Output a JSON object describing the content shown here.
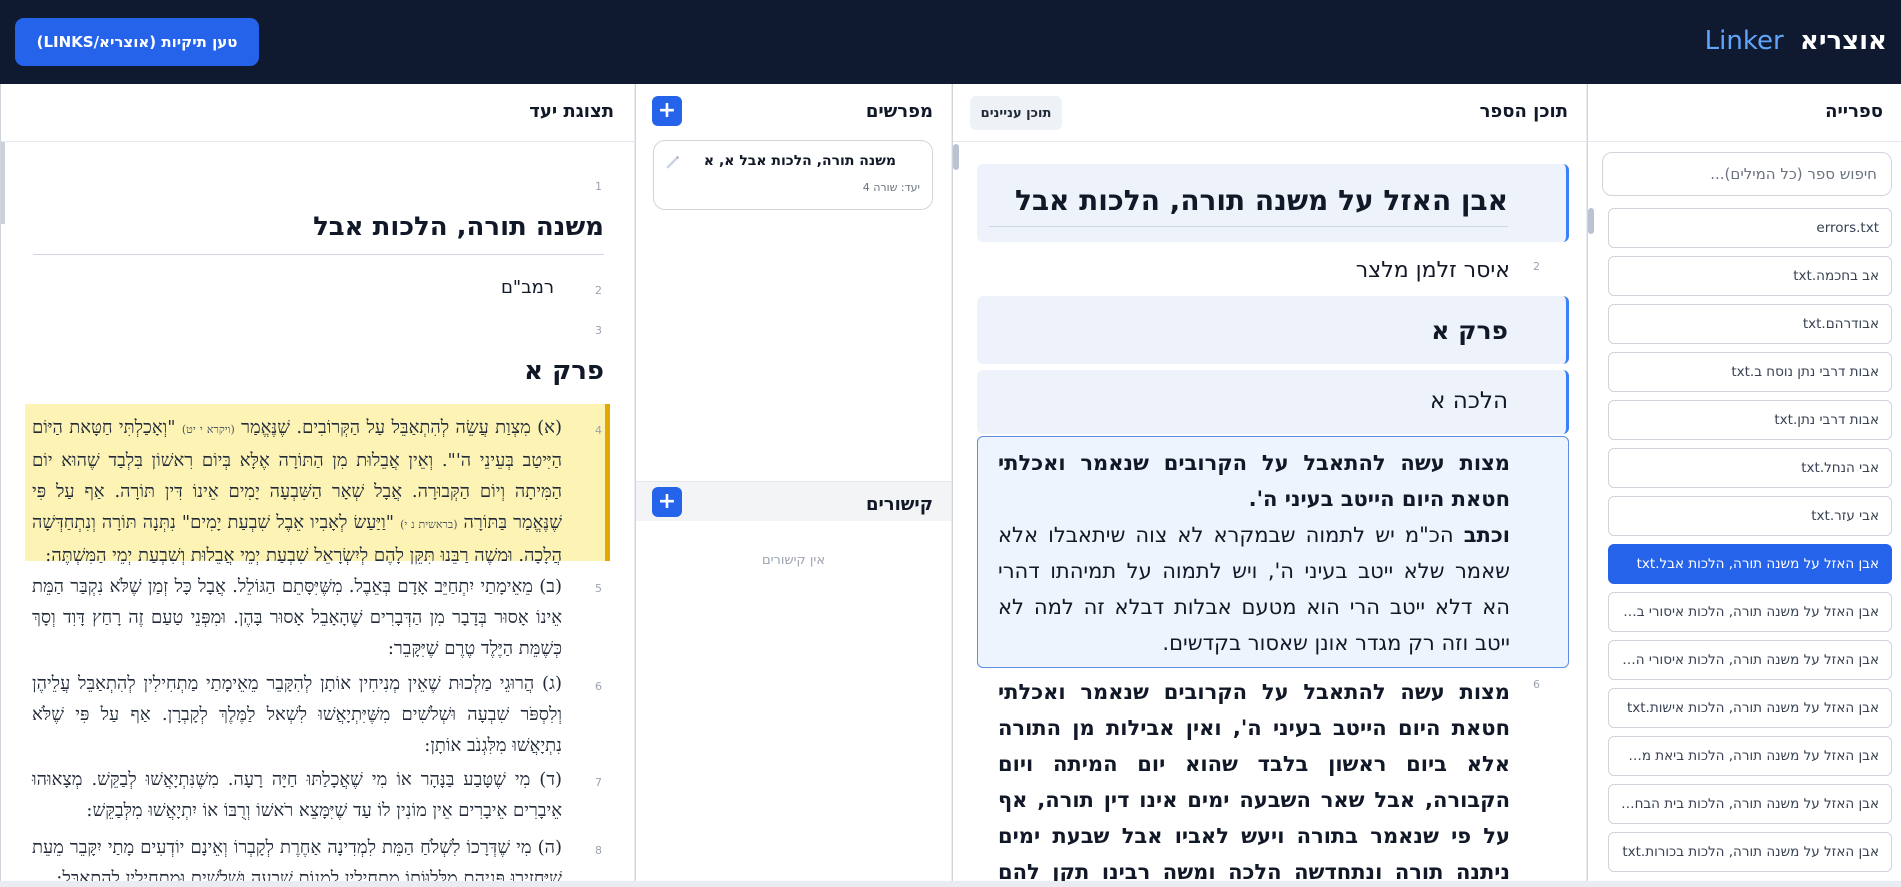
{
  "header": {
    "brand_main": "אוצריא",
    "brand_sub": "Linker",
    "load_button": "טען תיקיות (אוצריא/LINKS)"
  },
  "library": {
    "title": "ספרייה",
    "search_placeholder": "חיפוש ספר (כל המילים)...",
    "items": [
      {
        "label": "errors.txt",
        "active": false
      },
      {
        "label": "אב בחכמה.txt",
        "active": false
      },
      {
        "label": "אבודרהם.txt",
        "active": false
      },
      {
        "label": "אבות דרבי נתן נוסח ב.txt",
        "active": false
      },
      {
        "label": "אבות דרבי נתן.txt",
        "active": false
      },
      {
        "label": "אבי הנחל.txt",
        "active": false
      },
      {
        "label": "אבי עזר.txt",
        "active": false
      },
      {
        "label": "אבן האזל על משנה תורה, הלכות אבל.txt",
        "active": true
      },
      {
        "label": "אבן האזל על משנה תורה, הלכות איסורי ביאה.txt",
        "active": false
      },
      {
        "label": "אבן האזל על משנה תורה, הלכות איסורי המזבח.txt",
        "active": false
      },
      {
        "label": "אבן האזל על משנה תורה, הלכות אישות.txt",
        "active": false
      },
      {
        "label": "אבן האזל על משנה תורה, הלכות ביאת מקדש.txt",
        "active": false
      },
      {
        "label": "אבן האזל על משנה תורה, הלכות בית הבחירה.txt",
        "active": false
      },
      {
        "label": "אבן האזל על משנה תורה, הלכות בכורות.txt",
        "active": false
      }
    ]
  },
  "book": {
    "title": "תוכן הספר",
    "toc_button": "תוכן עניינים",
    "lines": {
      "l1": {
        "num": "1",
        "text": "אבן האזל על משנה תורה, הלכות אבל"
      },
      "l2": {
        "num": "2",
        "text": "איסר זלמן מלצר"
      },
      "l3": {
        "num": "3",
        "text": "פרק א"
      },
      "l4": {
        "num": "4",
        "text": "הלכה א"
      },
      "l5": {
        "num": "5",
        "bold": "מצות עשה להתאבל על הקרובים שנאמר ואכלתי חטאת היום הייטב בעיני ה'.",
        "lead": "וכתב",
        "rest": " הכ\"מ יש לתמוה שבמקרא לא צוה שיתאבלו אלא שאמר שלא ייטב בעיני ה', ויש לתמוה על תמיהתו דהרי הא דלא ייטב הרי הוא מטעם אבלות דבלא זה למה לא ייטב וזה רק מגדר אונן שאסור בקדשים."
      },
      "l6": {
        "num": "6",
        "text": "מצות עשה להתאבל על הקרובים שנאמר ואכלתי חטאת היום הייטב בעיני ה', ואין אבילות מן התורה אלא ביום ראשון בלבד שהוא יום המיתה ויום הקבורה, אבל שאר השבעה ימים אינו דין תורה, אף על פי שנאמר בתורה ויעש לאביו אבל שבעת ימים ניתנה תורה ונתחדשה הלכה ומשה רבינו תקן להם לישראל שבעת ימי אבלות ושבעת ימי המשתה."
      }
    }
  },
  "commentaries": {
    "title": "מפרשים",
    "add_label": "+",
    "card_title": "משנה תורה, הלכות אבל א, א",
    "card_sub": "יעד: שורה 4",
    "links_title": "קישורים",
    "links_add": "+",
    "links_empty": "אין קישורים"
  },
  "target": {
    "title": "תצוגת יעד",
    "n1": "1",
    "doc_title": "משנה תורה, הלכות אבל",
    "n2": "2",
    "author": "רמב\"ם",
    "n3": "3",
    "chapter": "פרק א",
    "p4": {
      "num": "4",
      "a": "(א) מִצְוַת עֲשֵׂה לְהִתְאַבֵּל עַל הַקְּרוֹבִים. שֶׁנֶּאֱמַר ",
      "ref1": "(ויקרא י יט)",
      "b": " \"וְאָכַלְתִּי חַטָּאת הַיּוֹם הַיִּיטַב בְּעֵינֵי ה'\". וְאֵין אֲבֵלוּת מִן הַתּוֹרָה אֶלָּא בְּיוֹם רִאשׁוֹן בִּלְבַד שֶׁהוּא יוֹם הַמִּיתָה וְיוֹם הַקְּבוּרָה. אֲבָל שְׁאָר הַשִּׁבְעָה יָמִים אֵינוֹ דִּין תּוֹרָה. אַף עַל פִּי שֶׁנֶּאֱמַר בַּתּוֹרָה ",
      "ref2": "(בראשית נ י)",
      "c": " \"וַיַּעַשׂ לְאָבִיו אֵבֶל שִׁבְעַת יָמִים\" נִתְּנָה תּוֹרָה וְנִתְחַדְּשָׁה הֲלָכָה. וּמשֶׁה רַבֵּנוּ תִּקֵּן לָהֶם לְיִשְׂרָאֵל שִׁבְעַת יְמֵי אֲבֵלוּת וְשִׁבְעַת יְמֵי הַמִּשְׁתֶּה:"
    },
    "p5": {
      "num": "5",
      "text": "(ב) מֵאֵימָתַי יִתְחַיֵּב אָדָם בְּאֵבֶל. מִשֶּׁיִּסָּתֵם הַגּוֹלֵל. אֲבָל כָּל זְמַן שֶׁלֹּא נִקְבַּר הַמֵּת אֵינוֹ אָסוּר בְּדָבָר מִן הַדְּבָרִים שֶׁהָאָבֵל אָסוּר בָּהֶן. וּמִפְּנֵי טַעַם זֶה רָחַץ דָּוִד וְסָךְ כְּשֶׁמֵּת הַיֶּלֶד טֶרֶם שֶׁיִּקָּבֵר:"
    },
    "p6": {
      "num": "6",
      "text": "(ג) הֲרוּגֵי מַלְכוּת שֶׁאֵין מְנִיחִין אוֹתָן לְהִקָּבֵר מֵאֵימָתַי מַתְחִילִין לְהִתְאַבֵּל עֲלֵיהֶן וְלִסְפֹּר שִׁבְעָה וּשְׁלֹשִׁים מִשֶּׁיִּתְיָאֲשׁוּ לִשְׁאל לַמֶּלֶךְ לְקָבְרָן. אַף עַל פִּי שֶׁלֹּא נִתְיָאֲשׁוּ מִלִּגְנֹב אוֹתָן:"
    },
    "p7": {
      "num": "7",
      "text": "(ד) מִי שֶׁטָּבַע בַּנָּהָר אוֹ מִי שֶׁאֲכָלַתּוּ חַיָּה רָעָה. מִשֶּׁנִּתְיָאֲשׁוּ לְבַקֵּשׁ. מְצָאוּהוּ אֵיבָרִים אֵיבָרִים אֵין מוֹנִין לוֹ עַד שֶׁיִּמָּצֵא רֹאשׁוֹ וְרֻבּוֹ אוֹ יִתְיָאֲשׁוּ מִלְּבַקֵּשׁ:"
    },
    "p8": {
      "num": "8",
      "text": "(ה) מִי שֶׁדְּרָכוֹ לִשְׁלֹחַ הַמֵּת לִמְדִינָה אַחֶרֶת לְקָבְרוֹ וְאֵינָם יוֹדְעִים מָתַי יִקָּבֵר מֵעֵת שֶׁיַּחְזִירוּ פְּנֵיהֶם מִלְּלַוּוֹתוֹ מַתְחִילִין לִמְנוֹת שִׁבְעָה וּשְׁלֹשִׁים וּמַתְחִילִין לְהִתְאַבֵּל:"
    }
  }
}
